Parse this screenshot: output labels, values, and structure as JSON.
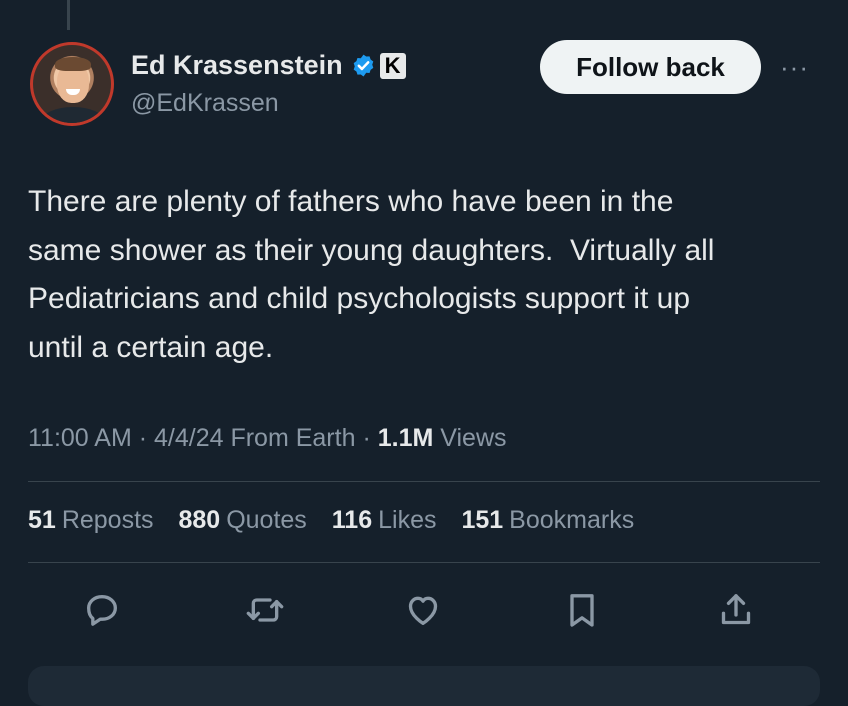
{
  "author": {
    "display_name": "Ed Krassenstein",
    "handle": "@EdKrassen",
    "badge_letter": "K"
  },
  "follow_button": {
    "label": "Follow back"
  },
  "more_label": "···",
  "tweet": {
    "text": "There are plenty of fathers who have been in the\nsame shower as their young daughters.  Virtually all\nPediatricians and child psychologists support it up\nuntil a certain age."
  },
  "meta": {
    "time": "11:00 AM",
    "sep1": " · ",
    "date": "4/4/24",
    "location": " From Earth",
    "sep2": " · ",
    "views_count": "1.1M",
    "views_label": " Views"
  },
  "stats": {
    "reposts_count": "51",
    "reposts_label": "Reposts",
    "quotes_count": "880",
    "quotes_label": "Quotes",
    "likes_count": "116",
    "likes_label": "Likes",
    "bookmarks_count": "151",
    "bookmarks_label": "Bookmarks"
  },
  "actions": {
    "reply_icon": "reply-icon",
    "repost_icon": "repost-icon",
    "like_icon": "heart-icon",
    "bookmark_icon": "bookmark-icon",
    "share_icon": "share-icon"
  },
  "colors": {
    "background": "#15202b",
    "text_primary": "#e7e9ea",
    "text_secondary": "#8b98a5",
    "verified_blue": "#1d9bf0",
    "avatar_ring": "#c0392b"
  }
}
